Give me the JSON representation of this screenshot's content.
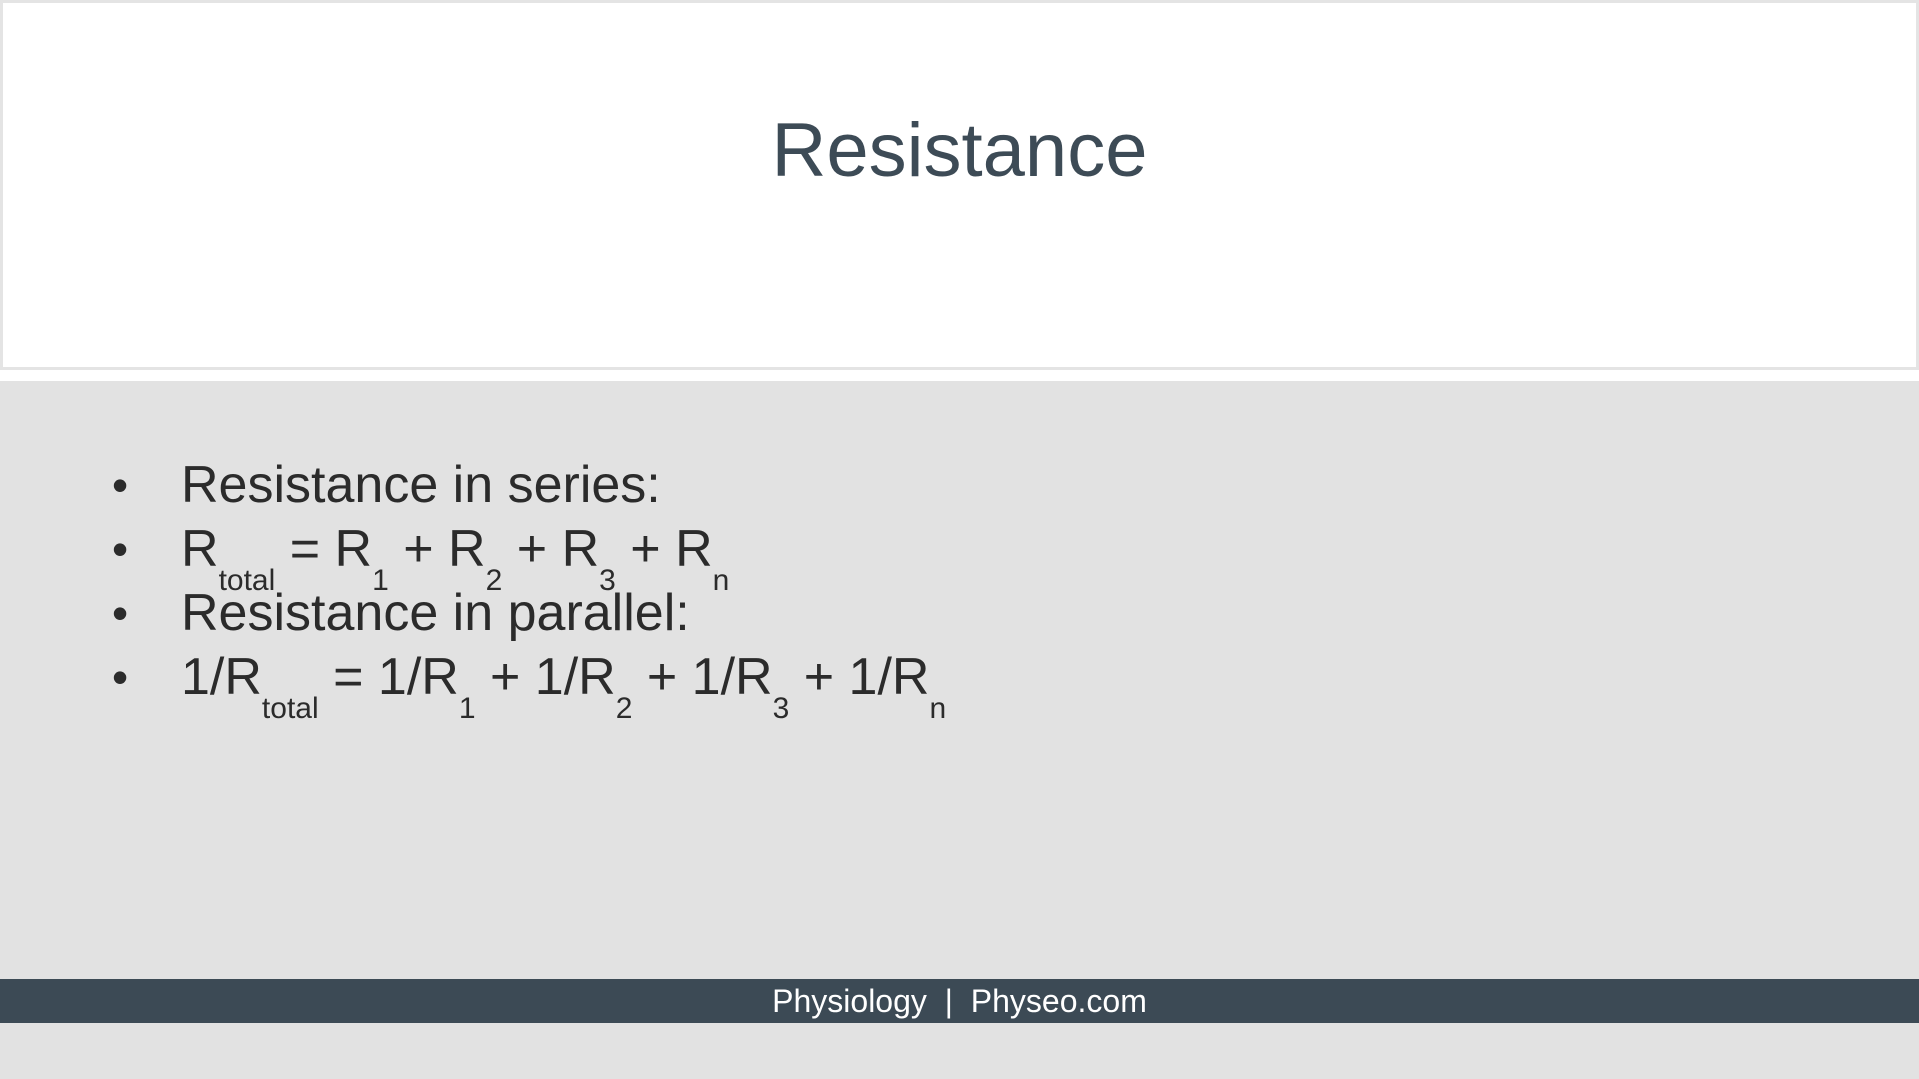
{
  "slide": {
    "title": "Resistance",
    "bullet_char": "•",
    "bullets": [
      {
        "segments": [
          {
            "text": "Resistance in series:",
            "sub": false
          }
        ]
      },
      {
        "segments": [
          {
            "text": "R",
            "sub": false
          },
          {
            "text": "total",
            "sub": true
          },
          {
            "text": " = R",
            "sub": false
          },
          {
            "text": "1",
            "sub": true
          },
          {
            "text": " + R",
            "sub": false
          },
          {
            "text": "2",
            "sub": true
          },
          {
            "text": " + R",
            "sub": false
          },
          {
            "text": "3",
            "sub": true
          },
          {
            "text": " + R",
            "sub": false
          },
          {
            "text": "n",
            "sub": true
          }
        ]
      },
      {
        "segments": [
          {
            "text": "Resistance in parallel:",
            "sub": false
          }
        ]
      },
      {
        "segments": [
          {
            "text": "1/R",
            "sub": false
          },
          {
            "text": "total",
            "sub": true
          },
          {
            "text": " = 1/R",
            "sub": false
          },
          {
            "text": "1",
            "sub": true
          },
          {
            "text": " + 1/R",
            "sub": false
          },
          {
            "text": "2",
            "sub": true
          },
          {
            "text": " + 1/R",
            "sub": false
          },
          {
            "text": "3",
            "sub": true
          },
          {
            "text": " + 1/R",
            "sub": false
          },
          {
            "text": "n",
            "sub": true
          }
        ]
      }
    ],
    "footer": {
      "left": "Physiology",
      "separator": "|",
      "right": "Physeo.com"
    }
  },
  "colors": {
    "title": "#3d4b56",
    "body_background": "#e2e2e2",
    "footer_background": "#3c4a55",
    "footer_text": "#ffffff"
  }
}
